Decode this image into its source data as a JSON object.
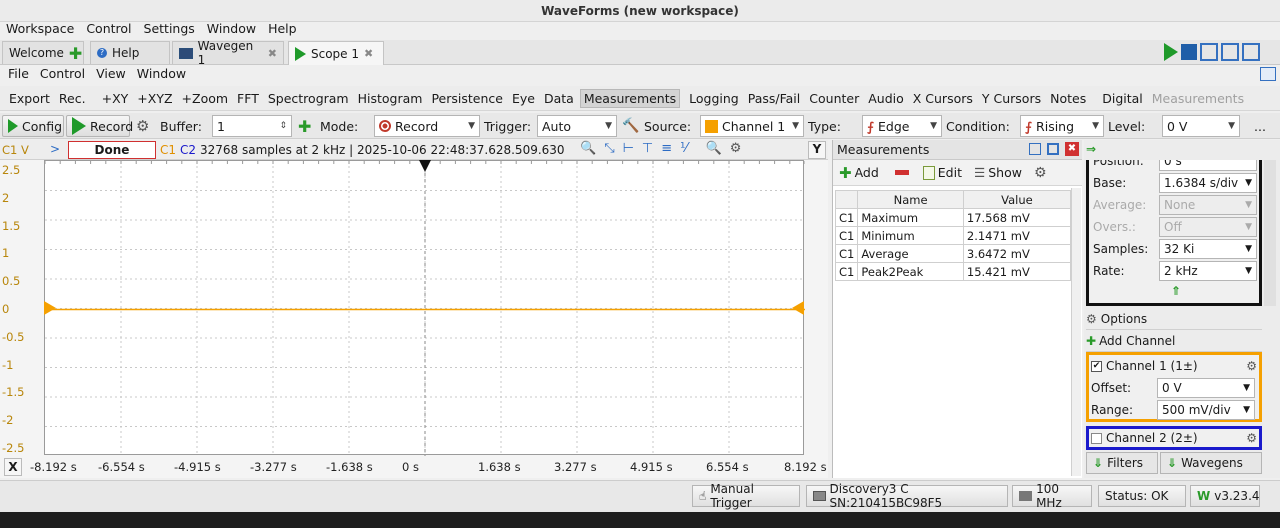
{
  "window": {
    "title": "WaveForms (new workspace)"
  },
  "main_menu": [
    "Workspace",
    "Control",
    "Settings",
    "Window",
    "Help"
  ],
  "tabs": [
    {
      "label": "Welcome",
      "icon": "plus-icon"
    },
    {
      "label": "Help",
      "icon": "help-icon"
    },
    {
      "label": "Wavegen 1",
      "icon": "wavegen-icon"
    },
    {
      "label": "Scope 1",
      "icon": "scope-icon",
      "active": true
    }
  ],
  "sub_menu": [
    "File",
    "Control",
    "View",
    "Window"
  ],
  "ribbon": [
    "Export",
    "Rec.",
    "+XY",
    "+XYZ",
    "+Zoom",
    "FFT",
    "Spectrogram",
    "Histogram",
    "Persistence",
    "Eye",
    "Data",
    "Measurements",
    "Logging",
    "Pass/Fail",
    "Counter",
    "Audio",
    "X Cursors",
    "Y Cursors",
    "Notes",
    "Digital"
  ],
  "ribbon_selected": "Measurements",
  "ribbon_dim": "Measurements",
  "controls": {
    "config": "Config",
    "record": "Record",
    "buffer_label": "Buffer:",
    "buffer_value": "1",
    "mode_label": "Mode:",
    "mode_value": "Record",
    "trigger_label": "Trigger:",
    "trigger_value": "Auto",
    "source_label": "Source:",
    "source_value": "Channel 1",
    "type_label": "Type:",
    "type_value": "Edge",
    "condition_label": "Condition:",
    "condition_value": "Rising",
    "level_label": "Level:",
    "level_value": "0 V",
    "more": "..."
  },
  "scope_status": {
    "y_unit": "C1 V",
    "state": "Done",
    "c1": "C1",
    "c2": "C2",
    "info": "32768 samples at 2 kHz | 2025-10-06 22:48:37.628.509.630",
    "y_button": "Y",
    "x_button": "X"
  },
  "y_ticks": [
    "2.5",
    "2",
    "1.5",
    "1",
    "0.5",
    "0",
    "-0.5",
    "-1",
    "-1.5",
    "-2",
    "-2.5"
  ],
  "x_ticks": [
    "-8.192 s",
    "-6.554 s",
    "-4.915 s",
    "-3.277 s",
    "-1.638 s",
    "0 s",
    "1.638 s",
    "3.277 s",
    "4.915 s",
    "6.554 s",
    "8.192 s"
  ],
  "measurements": {
    "title": "Measurements",
    "add": "Add",
    "edit": "Edit",
    "show": "Show",
    "headers": [
      "Name",
      "Value"
    ],
    "rows": [
      {
        "ch": "C1",
        "name": "Maximum",
        "value": "17.568 mV"
      },
      {
        "ch": "C1",
        "name": "Minimum",
        "value": "2.1471 mV"
      },
      {
        "ch": "C1",
        "name": "Average",
        "value": "3.6472 mV"
      },
      {
        "ch": "C1",
        "name": "Peak2Peak",
        "value": "15.421 mV"
      }
    ]
  },
  "time_panel": {
    "position_label": "Position:",
    "position_value": "0 s",
    "base_label": "Base:",
    "base_value": "1.6384 s/div",
    "average_label": "Average:",
    "average_value": "None",
    "overs_label": "Overs.:",
    "overs_value": "Off",
    "samples_label": "Samples:",
    "samples_value": "32 Ki",
    "rate_label": "Rate:",
    "rate_value": "2 kHz"
  },
  "options_label": "Options",
  "add_channel_label": "Add Channel",
  "channel1": {
    "label": "Channel 1 (1±)",
    "offset_label": "Offset:",
    "offset_value": "0 V",
    "range_label": "Range:",
    "range_value": "500 mV/div",
    "color": "#f5a000"
  },
  "channel2": {
    "label": "Channel 2 (2±)",
    "color": "#1a1acc"
  },
  "filters_label": "Filters",
  "wavegens_label": "Wavegens",
  "statusbar": {
    "manual_trigger": "Manual Trigger",
    "device": "Discovery3 C SN:210415BC98F5",
    "clock": "100 MHz",
    "status": "Status: OK",
    "version": "v3.23.4"
  }
}
